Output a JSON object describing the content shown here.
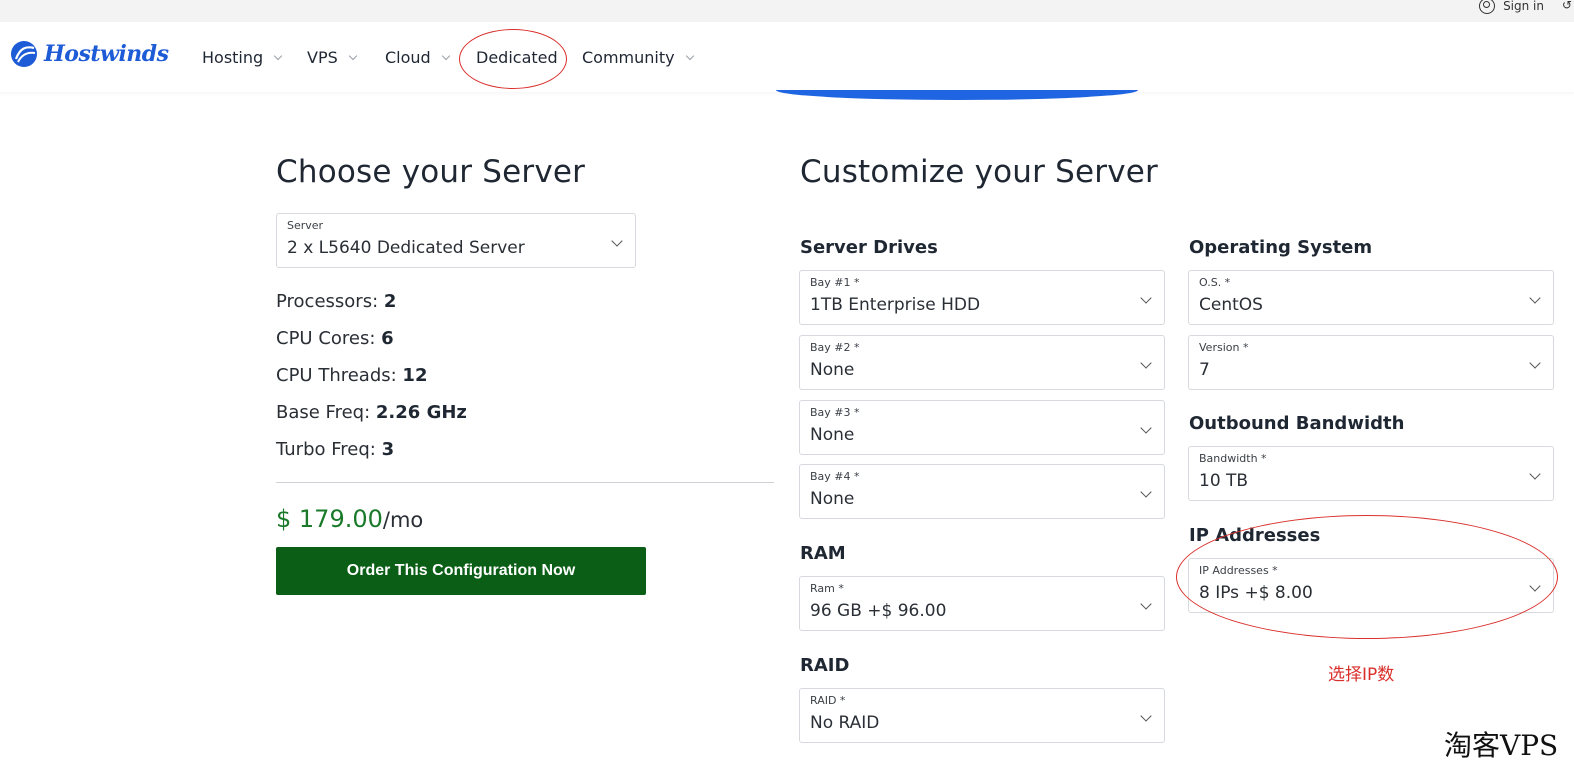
{
  "header": {
    "brand": "Hostwinds",
    "signin": "Sign in",
    "nav": [
      {
        "label": "Hosting"
      },
      {
        "label": "VPS"
      },
      {
        "label": "Cloud"
      },
      {
        "label": "Dedicated"
      },
      {
        "label": "Community"
      }
    ]
  },
  "left": {
    "title": "Choose your Server",
    "server": {
      "label": "Server",
      "value": "2 x L5640 Dedicated Server"
    },
    "specs": [
      {
        "label": "Processors: ",
        "value": "2"
      },
      {
        "label": "CPU Cores: ",
        "value": "6"
      },
      {
        "label": "CPU Threads: ",
        "value": "12"
      },
      {
        "label": "Base Freq: ",
        "value": "2.26 GHz"
      },
      {
        "label": "Turbo Freq: ",
        "value": "3"
      }
    ],
    "price": "$ 179.00",
    "price_period": "/mo",
    "order_button": "Order This Configuration Now"
  },
  "customize": {
    "title": "Customize your Server",
    "drives": {
      "heading": "Server Drives",
      "bays": [
        {
          "label": "Bay #1 *",
          "value": "1TB Enterprise HDD"
        },
        {
          "label": "Bay #2 *",
          "value": "None"
        },
        {
          "label": "Bay #3 *",
          "value": "None"
        },
        {
          "label": "Bay #4 *",
          "value": "None"
        }
      ]
    },
    "ram": {
      "heading": "RAM",
      "label": "Ram *",
      "value": "96 GB +$ 96.00"
    },
    "raid": {
      "heading": "RAID",
      "label": "RAID *",
      "value": "No RAID"
    },
    "os": {
      "heading": "Operating System",
      "os_label": "O.S. *",
      "os_value": "CentOS",
      "version_label": "Version *",
      "version_value": "7"
    },
    "bandwidth": {
      "heading": "Outbound Bandwidth",
      "label": "Bandwidth *",
      "value": "10 TB"
    },
    "ip": {
      "heading": "IP Addresses",
      "label": "IP Addresses *",
      "value": "8 IPs +$ 8.00"
    }
  },
  "annotation": "选择IP数",
  "watermark": "淘客VPS",
  "colors": {
    "brand_blue": "#1e5bd6",
    "order_green": "#0b5e16",
    "price_green": "#1a7a2a",
    "annotation_red": "#d9302c"
  }
}
